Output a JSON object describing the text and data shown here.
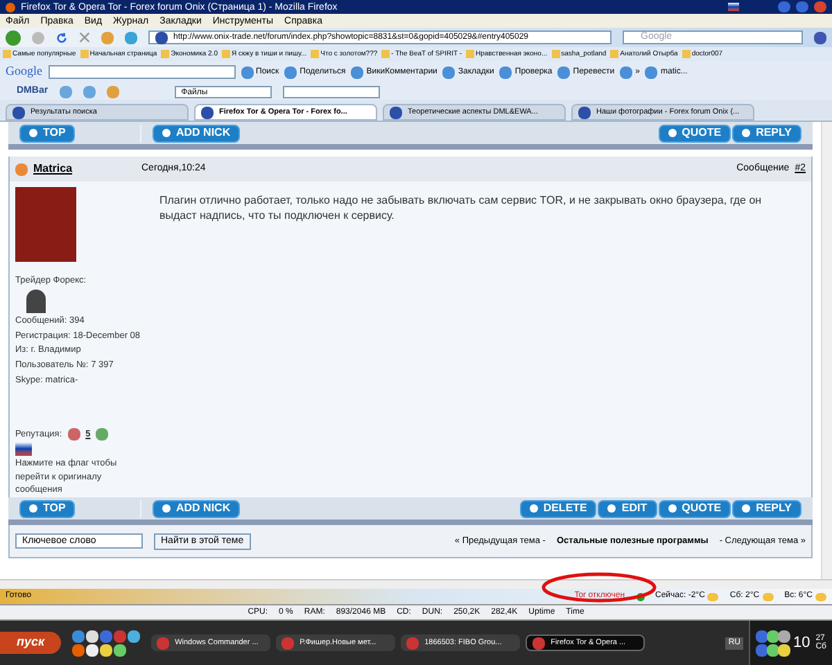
{
  "window": {
    "title": "Firefox Tor & Opera Tor - Forex forum Onix (Страница 1) - Mozilla Firefox"
  },
  "menu": [
    "Файл",
    "Правка",
    "Вид",
    "Журнал",
    "Закладки",
    "Инструменты",
    "Справка"
  ],
  "address": {
    "url": "http://www.onix-trade.net/forum/index.php?showtopic=8831&st=0&gopid=405029&#entry405029"
  },
  "search": {
    "placeholder": "Google"
  },
  "bookmarks": [
    "Самые популярные",
    "Начальная страница",
    "Экономика 2.0",
    "Я скжу в тиши и пишу...",
    "Что с золотом???",
    "- The BeaT of SPIRIT -",
    "Нравственная эконо...",
    "sasha_potland",
    "Анатолий Отырба",
    "doctor007"
  ],
  "google_bar": {
    "logo": "Google",
    "items": [
      "Поиск",
      "Поделиться",
      "ВикиКомментарии",
      "Закладки",
      "Проверка",
      "Перевести",
      "»",
      "matic..."
    ]
  },
  "dmbar": {
    "logo": "DMBar",
    "dropdown": "Файлы"
  },
  "tabs": [
    {
      "label": "Результаты поиска",
      "selected": false
    },
    {
      "label": "Firefox Tor & Opera Tor - Forex fo...",
      "selected": true
    },
    {
      "label": "Теоретические аспекты DML&EWA...",
      "selected": false
    },
    {
      "label": "Наши фотографии - Forex forum Onix (...",
      "selected": false
    }
  ],
  "top_bar": {
    "left": [
      "TOP",
      "ADD NICK"
    ],
    "right": [
      "QUOTE",
      "REPLY"
    ]
  },
  "post": {
    "author": "Matrica",
    "date": "Сегодня,10:24",
    "label": "Сообщение",
    "number": "#2",
    "text": "Плагин отлично работает, только надо не забывать включать сам сервис TOR, и не закрывать окно браузера, где он выдаст надпись, что ты подключен к сервису.",
    "rank": "Трейдер Форекс:",
    "info": [
      "Сообщений: 394",
      "Регистрация: 18-December 08",
      "Из: г. Владимир",
      "Пользователь №: 7 397",
      "Skype: matrica-"
    ],
    "reputation_label": "Репутация:",
    "reputation": "5",
    "flag_note": "Нажмите на флаг чтобы перейти к оригиналу сообщения"
  },
  "bottom_bar": {
    "left": [
      "TOP",
      "ADD NICK"
    ],
    "right": [
      "DELETE",
      "EDIT",
      "QUOTE",
      "REPLY"
    ]
  },
  "topic_search": {
    "value": "Ключевое слово",
    "button": "Найти в этой теме",
    "prev": "« Предыдущая тема -",
    "current": "Остальные полезные программы",
    "next": "- Следующая тема »"
  },
  "status_bar": {
    "text": "Готово",
    "tor": "Tor отключен",
    "weather": [
      "Сейчас: -2°C",
      "Сб: 2°C",
      "Вс: 6°C"
    ]
  },
  "stats_bar": [
    "CPU:",
    "0 %",
    "RAM:",
    "893/2046 MB",
    "CD:",
    "DUN:",
    "250,2K",
    "282,4K",
    "Uptime",
    "Time"
  ],
  "taskbar": {
    "start": "пуск",
    "tasks": [
      {
        "label": "Windows Commander ...",
        "selected": false
      },
      {
        "label": "Р.Фишер.Новые мет...",
        "selected": false
      },
      {
        "label": "1866503: FIBO Grou...",
        "selected": false
      },
      {
        "label": "Firefox Tor & Opera ...",
        "selected": true
      }
    ],
    "lang": "RU",
    "time": "10",
    "minutes": "27",
    "day": "Сб"
  }
}
